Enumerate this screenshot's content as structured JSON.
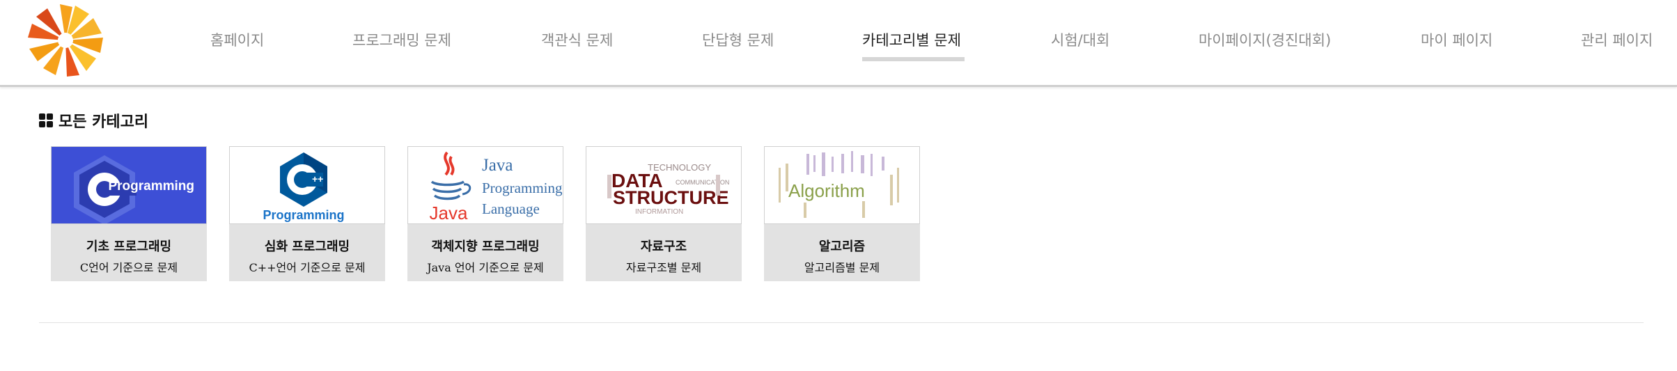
{
  "nav": {
    "items": [
      {
        "label": "홈페이지"
      },
      {
        "label": "프로그래밍 문제"
      },
      {
        "label": "객관식 문제"
      },
      {
        "label": "단답형 문제"
      },
      {
        "label": "카테고리별 문제",
        "active": true
      },
      {
        "label": "시험/대회"
      },
      {
        "label": "마이페이지(경진대회)"
      },
      {
        "label": "마이 페이지"
      },
      {
        "label": "관리 페이지"
      }
    ]
  },
  "section": {
    "title": "모든 카테고리",
    "icon": "grid-icon"
  },
  "cards": [
    {
      "title": "기초 프로그래밍",
      "desc": "C언어 기준으로 문제",
      "thumb_text": "Programming",
      "icon": "c-programming-logo"
    },
    {
      "title": "심화 프로그래밍",
      "desc": "C++언어 기준으로 문제",
      "thumb_text": "Programming",
      "icon": "cpp-programming-logo"
    },
    {
      "title": "객체지향 프로그래밍",
      "desc": "Java 언어 기준으로 문제",
      "thumb_text": [
        "Java",
        "Programming",
        "Language",
        "Java"
      ],
      "icon": "java-logo"
    },
    {
      "title": "자료구조",
      "desc": "자료구조별 문제",
      "thumb_text": [
        "DATA",
        "STRUCTURE",
        "TECHNOLOGY",
        "INFORMATION",
        "COMMUNICATION"
      ],
      "icon": "data-structure-wordcloud"
    },
    {
      "title": "알고리즘",
      "desc": "알고리즘별 문제",
      "thumb_text": [
        "Algorithm"
      ],
      "icon": "algorithm-wordcloud"
    }
  ],
  "colors": {
    "c_blue": "#3d4fd6",
    "cpp_blue": "#00599c",
    "java_red": "#e5382b",
    "java_blue": "#3a6ea8",
    "ds_red": "#6b0f0f",
    "nav_active": "#222222",
    "nav_inactive": "#8a8a8a"
  }
}
